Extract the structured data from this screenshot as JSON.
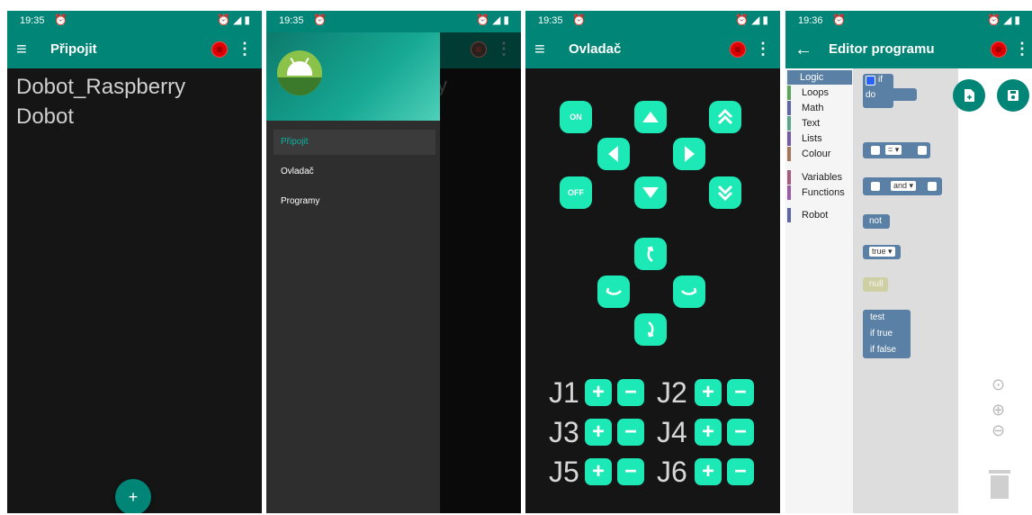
{
  "status": {
    "times": [
      "19:35",
      "19:35",
      "19:35",
      "19:36"
    ],
    "alarm_glyph": "⏰",
    "signal_glyph": "◢",
    "battery_glyph": "▮"
  },
  "screen1": {
    "title": "Připojit",
    "menu_icon": "≡",
    "more_icon": "⋮",
    "devices": [
      "Dobot_Raspberry",
      "Dobot"
    ],
    "fab_label": "+"
  },
  "screen2": {
    "menu_items": [
      "Připojit",
      "Ovladač",
      "Programy"
    ],
    "ghost_text": "y"
  },
  "screen3": {
    "title": "Ovladač",
    "on_label": "ON",
    "off_label": "OFF",
    "joints": [
      "J1",
      "J2",
      "J3",
      "J4",
      "J5",
      "J6"
    ],
    "plus": "+",
    "minus": "−"
  },
  "screen4": {
    "title": "Editor programu",
    "back_icon": "←",
    "categories": [
      {
        "label": "Logic",
        "color": "#5b80a5"
      },
      {
        "label": "Loops",
        "color": "#5ba55b"
      },
      {
        "label": "Math",
        "color": "#5b67a5"
      },
      {
        "label": "Text",
        "color": "#5ba58c"
      },
      {
        "label": "Lists",
        "color": "#745ba5"
      },
      {
        "label": "Colour",
        "color": "#a5745b"
      },
      {
        "label": "Variables",
        "color": "#a55b80"
      },
      {
        "label": "Functions",
        "color": "#995ba5"
      },
      {
        "label": "Robot",
        "color": "#5b67a5"
      }
    ],
    "blocks": {
      "if_label": "if",
      "do_label": "do",
      "eq_label": "= ▾",
      "and_label": "and ▾",
      "not_label": "not",
      "true_label": "true ▾",
      "null_label": "null",
      "test_label": "test",
      "iftrue_label": "if true",
      "iffalse_label": "if false"
    },
    "zoom_in": "⊕",
    "zoom_out": "⊖",
    "center_icon": "⊙"
  },
  "colors": {
    "primary": "#008577",
    "accent": "#1de9b6",
    "stop": "#e10000",
    "logic": "#5b80a5"
  }
}
